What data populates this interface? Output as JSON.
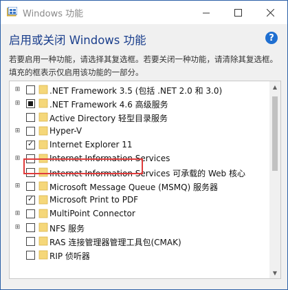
{
  "window": {
    "title": "Windows 功能"
  },
  "dialog": {
    "heading": "启用或关闭 Windows 功能",
    "help": "?",
    "description": "若要启用一种功能，请选择其复选框。若要关闭一种功能，请清除其复选框。填充的框表示仅启用该功能的一部分。"
  },
  "features": [
    {
      "label": ".NET Framework 3.5 (包括 .NET 2.0 和 3.0)",
      "expandable": true,
      "state": "unchecked"
    },
    {
      "label": ".NET Framework 4.6 高级服务",
      "expandable": true,
      "state": "partial"
    },
    {
      "label": "Active Directory 轻型目录服务",
      "expandable": false,
      "state": "unchecked"
    },
    {
      "label": "Hyper-V",
      "expandable": true,
      "state": "unchecked"
    },
    {
      "label": "Internet Explorer 11",
      "expandable": false,
      "state": "checked"
    },
    {
      "label": "Internet Information Services",
      "expandable": true,
      "state": "unchecked"
    },
    {
      "label": "Internet Information Services 可承载的 Web 核心",
      "expandable": false,
      "state": "unchecked"
    },
    {
      "label": "Microsoft Message Queue (MSMQ) 服务器",
      "expandable": true,
      "state": "unchecked"
    },
    {
      "label": "Microsoft Print to PDF",
      "expandable": false,
      "state": "checked"
    },
    {
      "label": "MultiPoint Connector",
      "expandable": true,
      "state": "unchecked"
    },
    {
      "label": "NFS 服务",
      "expandable": true,
      "state": "unchecked"
    },
    {
      "label": "RAS 连接管理器管理工具包(CMAK)",
      "expandable": false,
      "state": "unchecked"
    },
    {
      "label": "RIP 侦听器",
      "expandable": false,
      "state": "unchecked"
    }
  ],
  "colors": {
    "heading": "#1a3e8c",
    "highlight": "#e03a3a",
    "folder": "#f5d77a"
  }
}
